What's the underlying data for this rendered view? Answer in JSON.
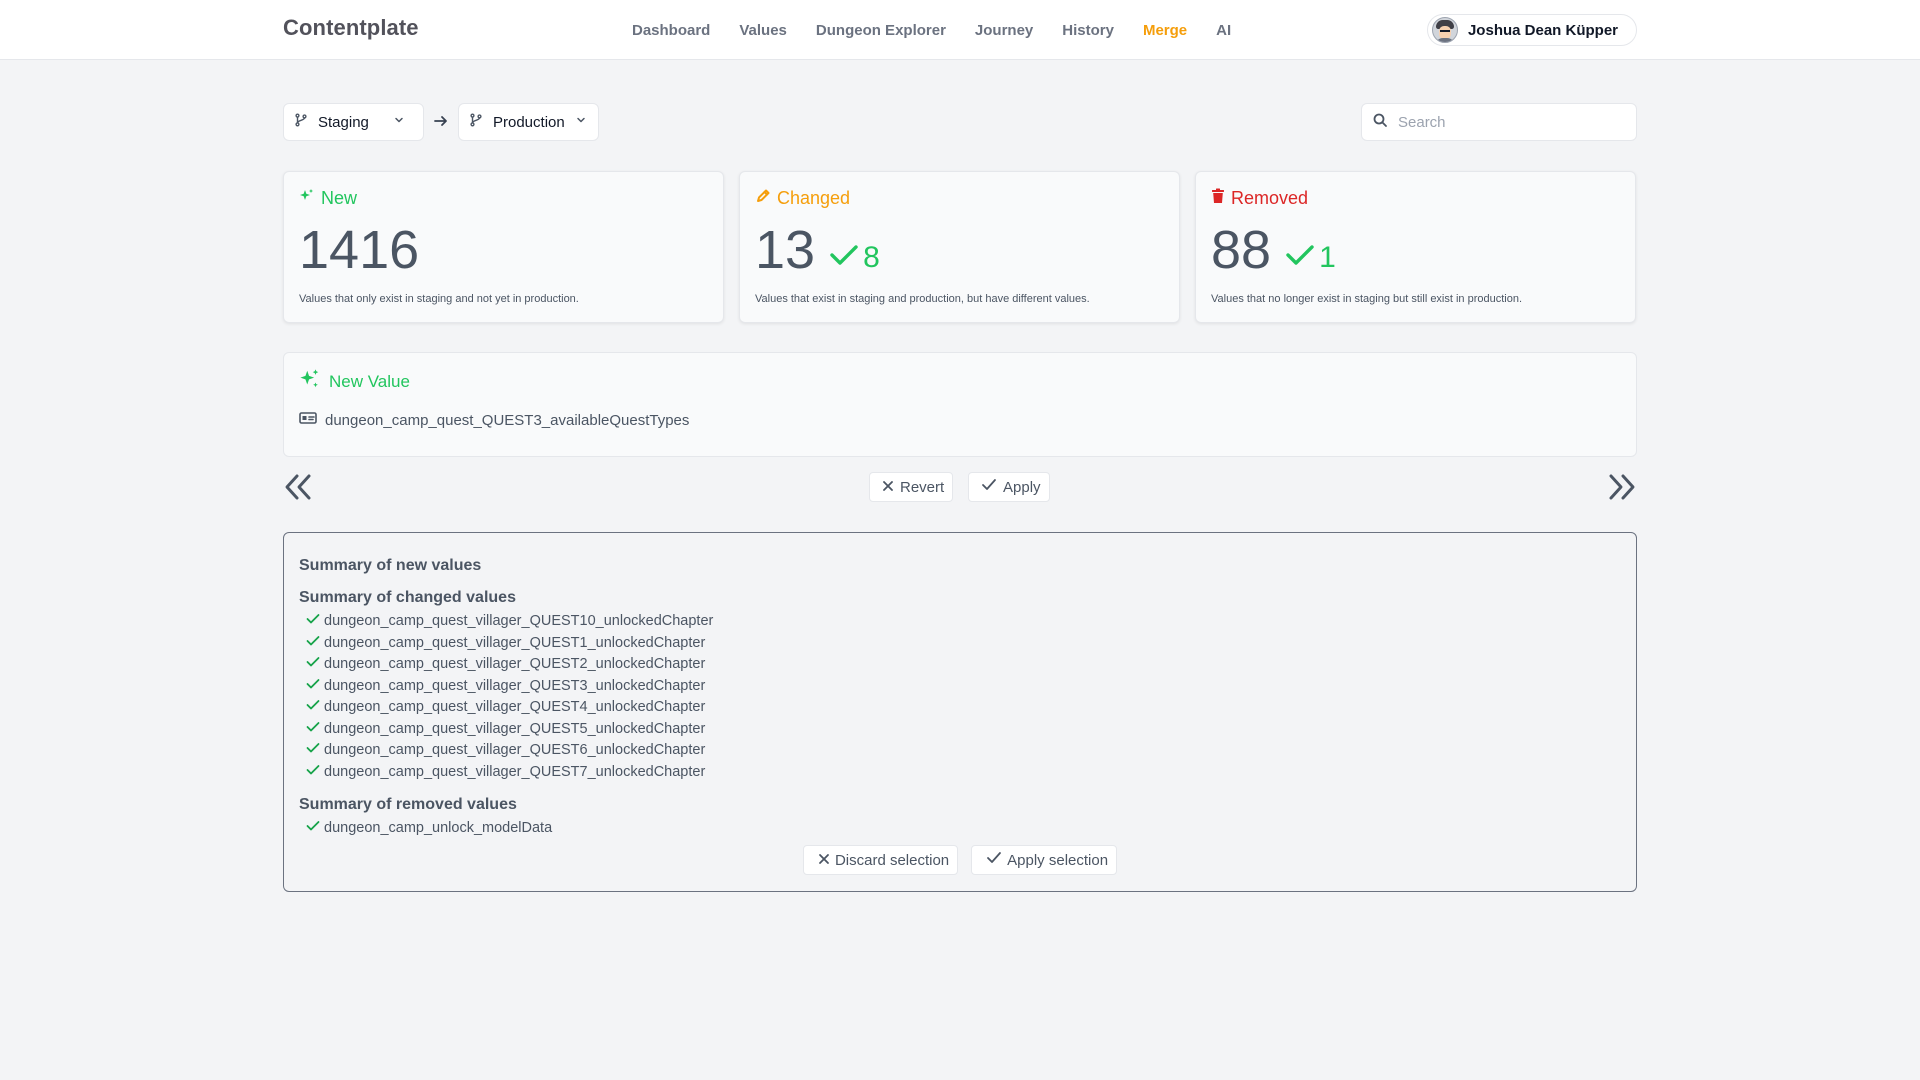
{
  "app": {
    "brand": "Contentplate"
  },
  "nav": {
    "items": [
      "Dashboard",
      "Values",
      "Dungeon Explorer",
      "Journey",
      "History",
      "Merge",
      "AI"
    ],
    "active": "Merge"
  },
  "user": {
    "name": "Joshua Dean Küpper"
  },
  "branches": {
    "source": "Staging",
    "target": "Production"
  },
  "search": {
    "placeholder": "Search",
    "value": ""
  },
  "cards": {
    "new": {
      "title": "New",
      "count": "1416",
      "desc": "Values that only exist in staging and not yet in production."
    },
    "changed": {
      "title": "Changed",
      "count": "13",
      "selected": "8",
      "desc": "Values that exist in staging and production, but have different values."
    },
    "removed": {
      "title": "Removed",
      "count": "88",
      "selected": "1",
      "desc": "Values that no longer exist in staging but still exist in production."
    }
  },
  "current": {
    "title": "New Value",
    "key": "dungeon_camp_quest_QUEST3_availableQuestTypes"
  },
  "actions": {
    "revert": "Revert",
    "apply": "Apply"
  },
  "summary": {
    "new_heading": "Summary of new values",
    "changed_heading": "Summary of changed values",
    "changed_items": [
      "dungeon_camp_quest_villager_QUEST10_unlockedChapter",
      "dungeon_camp_quest_villager_QUEST1_unlockedChapter",
      "dungeon_camp_quest_villager_QUEST2_unlockedChapter",
      "dungeon_camp_quest_villager_QUEST3_unlockedChapter",
      "dungeon_camp_quest_villager_QUEST4_unlockedChapter",
      "dungeon_camp_quest_villager_QUEST5_unlockedChapter",
      "dungeon_camp_quest_villager_QUEST6_unlockedChapter",
      "dungeon_camp_quest_villager_QUEST7_unlockedChapter"
    ],
    "removed_heading": "Summary of removed values",
    "removed_items": [
      "dungeon_camp_unlock_modelData"
    ],
    "discard": "Discard selection",
    "apply": "Apply selection"
  },
  "colors": {
    "accent": "#f59e0b",
    "new": "#22c55e",
    "changed": "#f59e0b",
    "removed": "#dc2626"
  },
  "icons": {
    "branch": "git-branch-icon",
    "chevron": "chevron-down-icon",
    "arrow": "arrow-right-icon",
    "search": "search-icon",
    "new": "sparkles-icon",
    "changed": "pencil-icon",
    "removed": "trash-icon",
    "key": "id-card-icon",
    "prev": "double-chevron-left-icon",
    "next": "double-chevron-right-icon",
    "check": "check-icon",
    "close": "close-icon"
  }
}
